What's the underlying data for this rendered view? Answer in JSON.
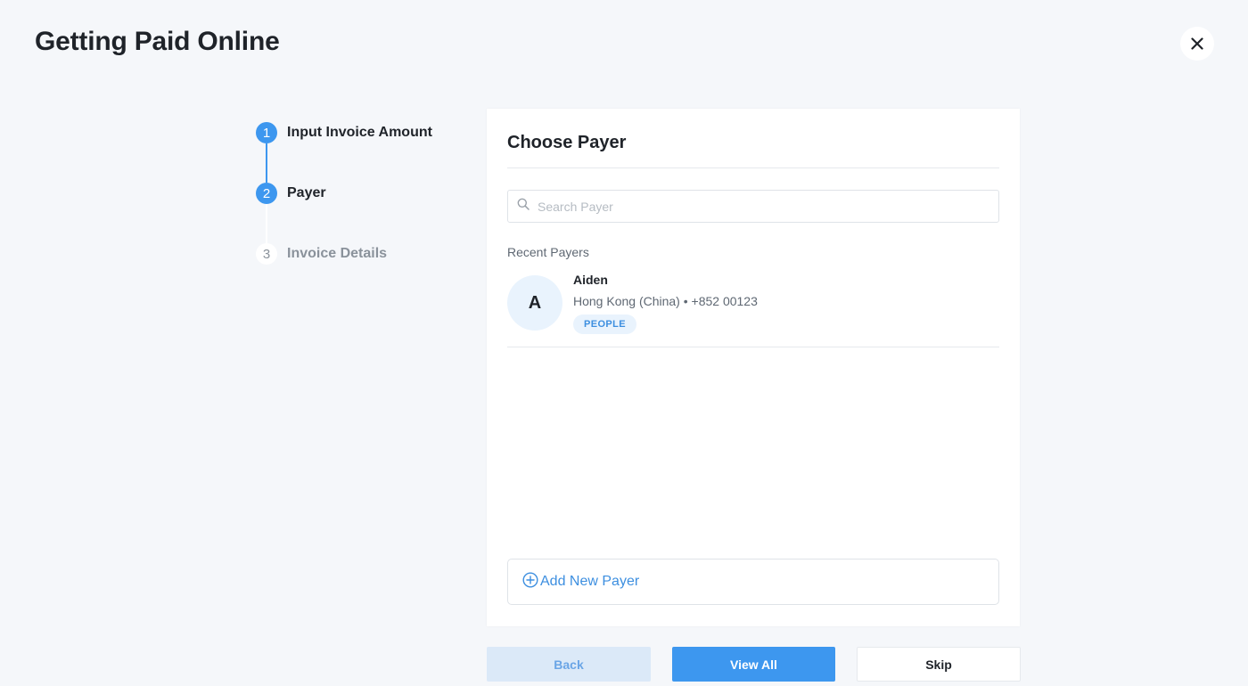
{
  "header": {
    "title": "Getting Paid Online",
    "close_icon": "close-icon"
  },
  "stepper": {
    "steps": [
      {
        "number": "1",
        "label": "Input Invoice Amount",
        "state": "completed"
      },
      {
        "number": "2",
        "label": "Payer",
        "state": "current"
      },
      {
        "number": "3",
        "label": "Invoice Details",
        "state": "upcoming"
      }
    ]
  },
  "card": {
    "title": "Choose Payer",
    "search": {
      "placeholder": "Search Payer",
      "value": "",
      "icon": "search-icon"
    },
    "recent_label": "Recent Payers",
    "payers": [
      {
        "initial": "A",
        "name": "Aiden",
        "details": "Hong Kong (China) • +852 00123",
        "badge": "PEOPLE"
      }
    ],
    "add_payer": {
      "label": "Add New Payer",
      "icon": "add-circle-icon"
    }
  },
  "footer": {
    "back_label": "Back",
    "view_all_label": "View All",
    "skip_label": "Skip"
  },
  "colors": {
    "accent": "#3d97ef",
    "background": "#f5f7fa",
    "badge_bg": "#e9f3fd"
  }
}
